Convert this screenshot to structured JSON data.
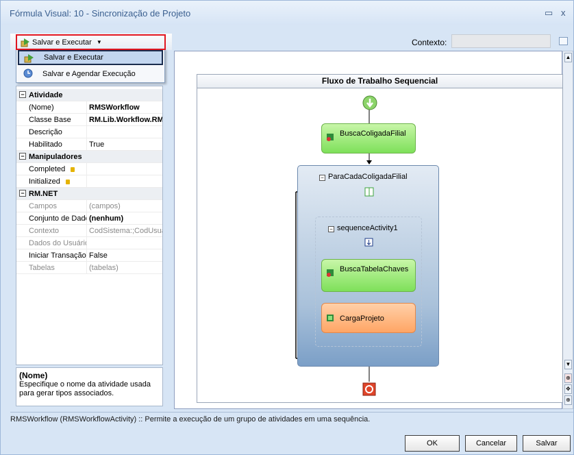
{
  "window": {
    "title": "Fórmula Visual: 10 - Sincronização de Projeto",
    "minimize_glyph": "▭",
    "close_glyph": "x"
  },
  "toolbar": {
    "run_button_label": "Salvar e Executar",
    "context_label": "Contexto:",
    "context_value": ""
  },
  "dropdown": {
    "items": [
      {
        "label": "Salvar e Executar",
        "icon": "save-run-icon"
      },
      {
        "label": "Salvar e Agendar Execução",
        "icon": "schedule-icon"
      }
    ]
  },
  "properties": {
    "categories": [
      {
        "name": "Atividade"
      },
      {
        "name": "Manipuladores"
      },
      {
        "name": "RM.NET"
      }
    ],
    "rows": [
      {
        "name": "(Nome)",
        "value": "RMSWorkflow"
      },
      {
        "name": "Classe Base",
        "value": "RM.Lib.Workflow.RMSWorkflow"
      },
      {
        "name": "Descrição",
        "value": ""
      },
      {
        "name": "Habilitado",
        "value": "True"
      },
      {
        "name": "Completed",
        "value": ""
      },
      {
        "name": "Initialized",
        "value": ""
      },
      {
        "name": "Campos",
        "value": "(campos)"
      },
      {
        "name": "Conjunto de Dados",
        "value": "(nenhum)"
      },
      {
        "name": "Contexto",
        "value": "CodSistema:;CodUsuario"
      },
      {
        "name": "Dados do Usuário",
        "value": ""
      },
      {
        "name": "Iniciar Transação",
        "value": "False"
      },
      {
        "name": "Tabelas",
        "value": "(tabelas)"
      }
    ]
  },
  "description": {
    "title": "(Nome)",
    "text": "Especifique o nome da atividade usada para gerar tipos associados."
  },
  "designer": {
    "header": "Fluxo de Trabalho Sequencial",
    "activity1": "BuscaColigadaFilial",
    "loop_label": "ParaCadaColigadaFilial",
    "sequence_label": "sequenceActivity1",
    "activity2": "BuscaTabelaChaves",
    "activity3": "CargaProjeto"
  },
  "status_text": "RMSWorkflow  (RMSWorkflowActivity)  :: Permite a execução de um grupo de atividades em uma sequência.",
  "buttons": {
    "ok": "OK",
    "cancel": "Cancelar",
    "save": "Salvar"
  }
}
